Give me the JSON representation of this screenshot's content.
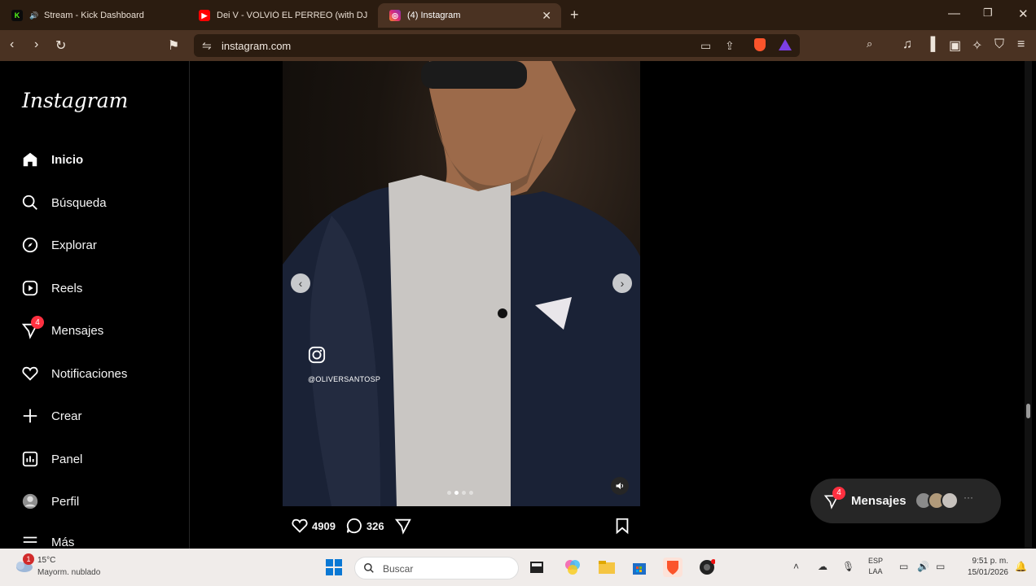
{
  "browser": {
    "tabs": [
      {
        "title": "Stream - Kick Dashboard",
        "favicon": "kick-icon",
        "color": "#53fc18"
      },
      {
        "title": "Dei V - VOLVIÓ EL PERREO (with DJ L",
        "favicon": "youtube-icon",
        "color": "#ff0000"
      },
      {
        "title": "(4) Instagram",
        "favicon": "instagram-icon",
        "color": "#d6249f",
        "active": true
      }
    ],
    "url": "instagram.com"
  },
  "sidebar": {
    "logo": "Instagram",
    "items": [
      {
        "label": "Inicio",
        "icon": "home-icon",
        "active": true
      },
      {
        "label": "Búsqueda",
        "icon": "search-icon"
      },
      {
        "label": "Explorar",
        "icon": "compass-icon"
      },
      {
        "label": "Reels",
        "icon": "reels-icon"
      },
      {
        "label": "Mensajes",
        "icon": "messenger-icon",
        "badge": "4"
      },
      {
        "label": "Notificaciones",
        "icon": "heart-icon"
      },
      {
        "label": "Crear",
        "icon": "plus-icon"
      },
      {
        "label": "Panel",
        "icon": "chart-icon"
      },
      {
        "label": "Perfil",
        "icon": "profile-icon"
      },
      {
        "label": "Más",
        "icon": "menu-icon"
      }
    ]
  },
  "post": {
    "watermark_handle": "@OLIVERSANTOSP",
    "likes": "4909",
    "comments": "326",
    "carousel_total": 4,
    "carousel_current": 2
  },
  "messages_pill": {
    "label": "Mensajes",
    "badge": "4"
  },
  "taskbar": {
    "weather_badge": "1",
    "temperature": "15°C",
    "weather_desc": "Mayorm. nublado",
    "search_placeholder": "Buscar",
    "lang_line1": "ESP",
    "lang_line2": "LAA",
    "time": "9:51 p. m.",
    "date": "15/01/2026"
  }
}
